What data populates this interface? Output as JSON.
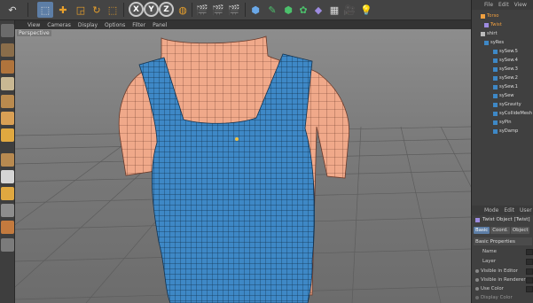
{
  "toolbar": {
    "undo_icon": "undo-icon",
    "axes": [
      "X",
      "Y",
      "Z"
    ]
  },
  "viewport": {
    "menu": [
      "View",
      "Cameras",
      "Display",
      "Options",
      "Filter",
      "Panel"
    ],
    "camera_label": "Perspective"
  },
  "object_manager": {
    "menu": [
      "File",
      "Edit",
      "View"
    ],
    "items": [
      {
        "label": "Torso",
        "color": "#f0a040"
      },
      {
        "label": "Twist",
        "color": "#f0a040"
      },
      {
        "label": "shirt",
        "color": "#dcdcdc"
      },
      {
        "label": "syRes",
        "color": "#dcdcdc"
      },
      {
        "label": "sySew.5",
        "color": "#dcdcdc"
      },
      {
        "label": "sySew.4",
        "color": "#dcdcdc"
      },
      {
        "label": "sySew.3",
        "color": "#dcdcdc"
      },
      {
        "label": "sySew.2",
        "color": "#dcdcdc"
      },
      {
        "label": "sySew.1",
        "color": "#dcdcdc"
      },
      {
        "label": "sySew",
        "color": "#dcdcdc"
      },
      {
        "label": "syGravity",
        "color": "#dcdcdc"
      },
      {
        "label": "syCollideMesh",
        "color": "#dcdcdc"
      },
      {
        "label": "syPin",
        "color": "#dcdcdc"
      },
      {
        "label": "syDamp",
        "color": "#dcdcdc"
      }
    ]
  },
  "attributes": {
    "menu": [
      "Mode",
      "Edit",
      "User"
    ],
    "title": "Twist Object [Twist]",
    "tabs": [
      "Basic",
      "Coord.",
      "Object"
    ],
    "section": "Basic Properties",
    "rows": [
      "Name",
      "Layer",
      "Visible in Editor",
      "Visible in Renderer",
      "Use Color",
      "Display Color"
    ]
  },
  "colors": {
    "selection": "#5d7ea6",
    "shirt": "#3e88c6",
    "mannequin": "#f0a98a"
  }
}
